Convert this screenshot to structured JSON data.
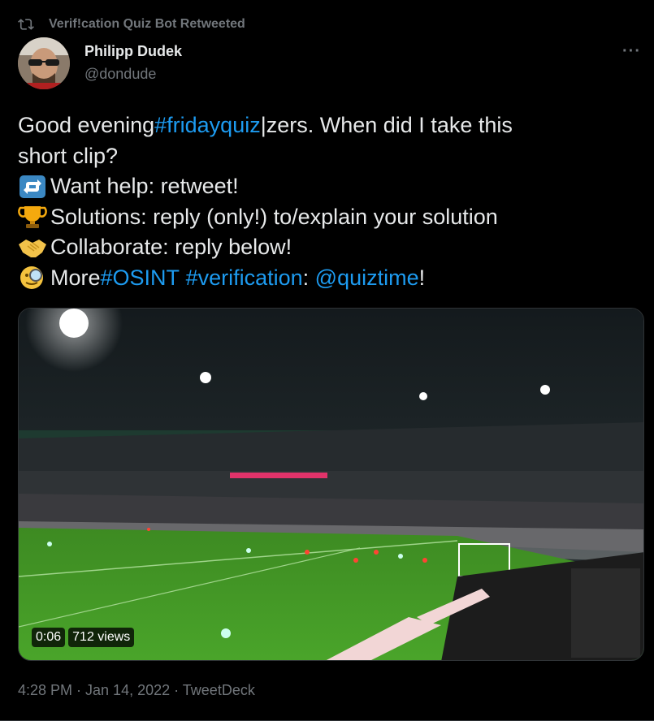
{
  "retweet": {
    "label": "Verif!cation Quiz Bot Retweeted"
  },
  "author": {
    "name": "Philipp Dudek",
    "handle": "@dondude"
  },
  "tweet": {
    "line1": {
      "a": "Good evening ",
      "hashtag": "#fridayquiz",
      "b": "|zers. When did I take this"
    },
    "line2": "short clip?",
    "line3": "Want help: retweet!",
    "line4": "Solutions: reply (only!) to/explain your solution",
    "line5": "Collaborate: reply below!",
    "line6": {
      "a": "More ",
      "h1": "#OSINT",
      "sp": " ",
      "h2": "#verification",
      "b": ": ",
      "mention": "@quiztime",
      "c": "!"
    }
  },
  "video": {
    "duration": "0:06",
    "views": "712 views"
  },
  "footer": {
    "timestamp": "4:28 PM · Jan 14, 2022 · TweetDeck"
  },
  "colors": {
    "link": "#1d9bf0",
    "muted": "#71767b",
    "text": "#e7e9ea",
    "background": "#000000"
  },
  "icons": [
    "retweet-icon",
    "more-icon",
    "repeat-emoji-icon",
    "trophy-emoji-icon",
    "handshake-emoji-icon",
    "magnifier-emoji-icon"
  ]
}
